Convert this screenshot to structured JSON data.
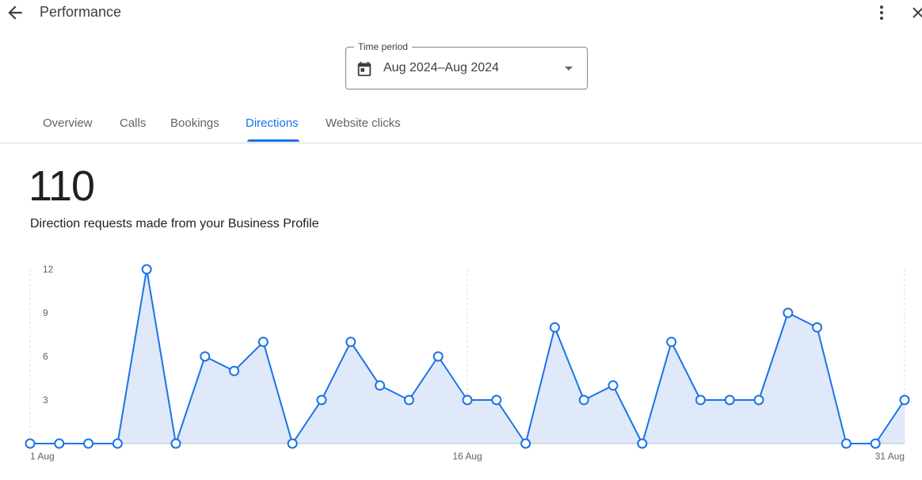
{
  "header": {
    "title": "Performance",
    "icons": [
      "arrow-back-icon",
      "more-vert-icon",
      "close-icon"
    ]
  },
  "time_period": {
    "label": "Time period",
    "value": "Aug 2024–Aug 2024",
    "icon": "calendar-icon"
  },
  "tabs": [
    {
      "label": "Overview",
      "active": false
    },
    {
      "label": "Calls",
      "active": false
    },
    {
      "label": "Bookings",
      "active": false
    },
    {
      "label": "Directions",
      "active": true
    },
    {
      "label": "Website clicks",
      "active": false
    }
  ],
  "summary": {
    "total": "110",
    "description": "Direction requests made from your Business Profile"
  },
  "colors": {
    "accent": "#1a73e8",
    "area_fill": "#dfe9f9",
    "grid": "#dadce0",
    "text": "#202124"
  },
  "chart_data": {
    "type": "area",
    "title": "",
    "xlabel": "",
    "ylabel": "",
    "ylim": [
      0,
      12
    ],
    "yticks": [
      "3",
      "6",
      "9",
      "12"
    ],
    "xtick_labels": [
      {
        "day": 1,
        "label": "1 Aug"
      },
      {
        "day": 16,
        "label": "16 Aug"
      },
      {
        "day": 31,
        "label": "31 Aug"
      }
    ],
    "x": [
      1,
      2,
      3,
      4,
      5,
      6,
      7,
      8,
      9,
      10,
      11,
      12,
      13,
      14,
      15,
      16,
      17,
      18,
      19,
      20,
      21,
      22,
      23,
      24,
      25,
      26,
      27,
      28,
      29,
      30,
      31
    ],
    "series": [
      {
        "values": [
          0,
          0,
          0,
          0,
          12,
          0,
          6,
          5,
          7,
          0,
          3,
          7,
          4,
          3,
          6,
          3,
          3,
          0,
          8,
          3,
          4,
          0,
          7,
          3,
          3,
          3,
          9,
          8,
          0,
          0,
          3
        ]
      }
    ],
    "grid": true,
    "markers": true
  }
}
